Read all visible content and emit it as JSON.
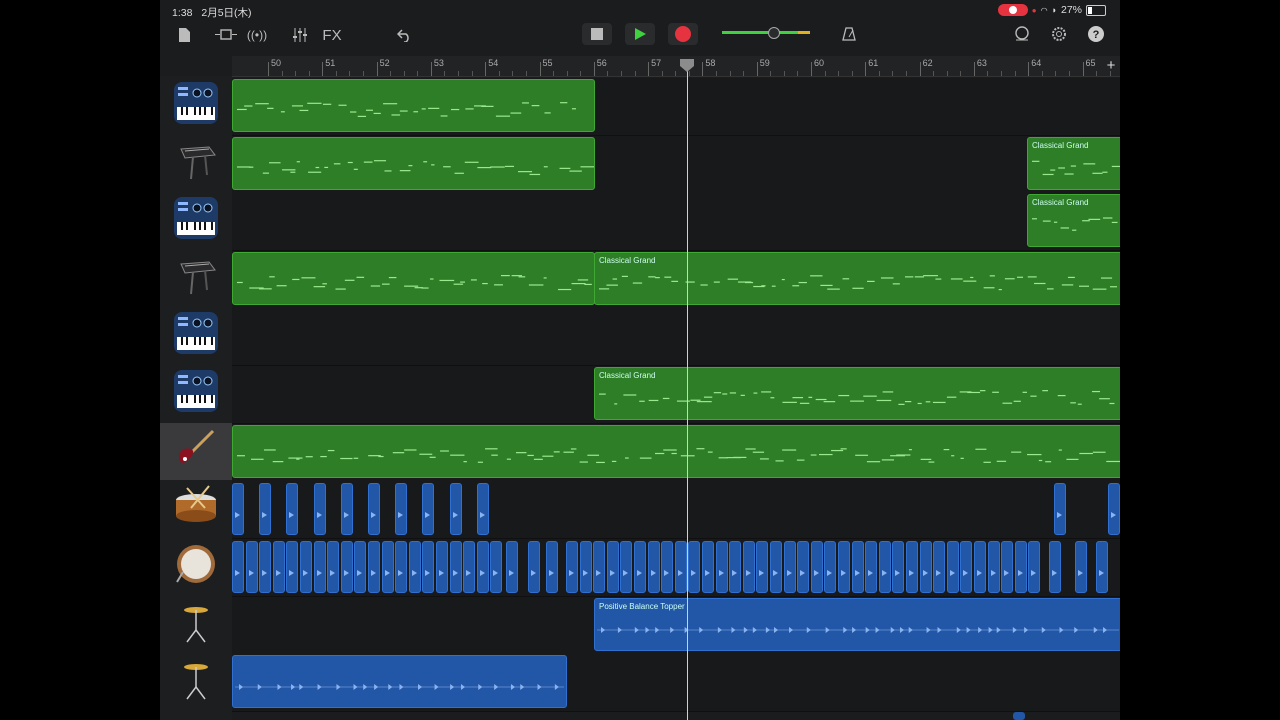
{
  "status_bar": {
    "time": "1:38",
    "date": "2月5日(木)",
    "battery": "27%"
  },
  "toolbar": {
    "fx_label": "FX"
  },
  "ruler": {
    "bars": [
      "50",
      "51",
      "52",
      "53",
      "54",
      "55",
      "56",
      "57",
      "58",
      "59",
      "60",
      "61",
      "62",
      "63",
      "64",
      "65"
    ]
  },
  "tracks": [
    {
      "instrument": "keyboard-synth",
      "regions": [
        {
          "label": "",
          "color": "green"
        }
      ]
    },
    {
      "instrument": "grand-piano",
      "regions": [
        {
          "label": "",
          "color": "green"
        },
        {
          "label": "Classical Grand",
          "color": "green"
        }
      ]
    },
    {
      "instrument": "keyboard-synth",
      "regions": [
        {
          "label": "Classical Grand",
          "color": "green"
        }
      ]
    },
    {
      "instrument": "grand-piano",
      "regions": [
        {
          "label": "",
          "color": "green"
        },
        {
          "label": "Classical Grand",
          "color": "green"
        }
      ]
    },
    {
      "instrument": "keyboard-synth",
      "regions": []
    },
    {
      "instrument": "keyboard-synth",
      "regions": [
        {
          "label": "Classical Grand",
          "color": "green"
        }
      ]
    },
    {
      "instrument": "electric-bass",
      "regions": [
        {
          "label": "",
          "color": "green"
        }
      ]
    },
    {
      "instrument": "snare-drum",
      "regions": []
    },
    {
      "instrument": "kick-drum",
      "regions": []
    },
    {
      "instrument": "cymbal",
      "regions": [
        {
          "label": "Positive Balance Topper",
          "color": "blue"
        }
      ]
    },
    {
      "instrument": "cymbal",
      "regions": [
        {
          "label": "",
          "color": "blue"
        }
      ]
    }
  ],
  "colors": {
    "midi_region": "#2e7d27",
    "audio_region": "#2257a8",
    "record": "#e5333f",
    "play": "#3fd13f"
  }
}
